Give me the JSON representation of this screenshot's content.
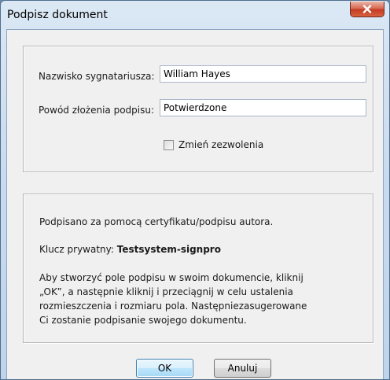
{
  "window": {
    "title": "Podpisz dokument"
  },
  "signature_group": {
    "signer_label": "Nazwisko sygnatariusza:",
    "signer_value": "William Hayes",
    "reason_label": "Powód złożenia podpisu:",
    "reason_value": "Potwierdzone",
    "permissions_label": "Zmień zezwolenia",
    "permissions_checked": false
  },
  "info_group": {
    "certificate_text": "Podpisano za pomocą certyfikatu/podpisu autora.",
    "private_key_label": "Klucz prywatny:",
    "private_key_value": "Testsystem-signpro",
    "instructions_line1": "Aby stworzyć pole podpisu w swoim dokumencie, kliknij",
    "instructions_line2": "„OK”, a następnie kliknij i przeciągnij w celu ustalenia",
    "instructions_line3": "rozmieszczenia i rozmiaru pola. Następniezasugerowane",
    "instructions_line4": "Ci zostanie podpisanie swojego dokumentu."
  },
  "buttons": {
    "ok_label": "OK",
    "cancel_label": "Anuluj"
  },
  "icons": {
    "close": "close-icon"
  },
  "colors": {
    "close_button": "#c43c22",
    "default_button_border": "#3c7fb1"
  }
}
